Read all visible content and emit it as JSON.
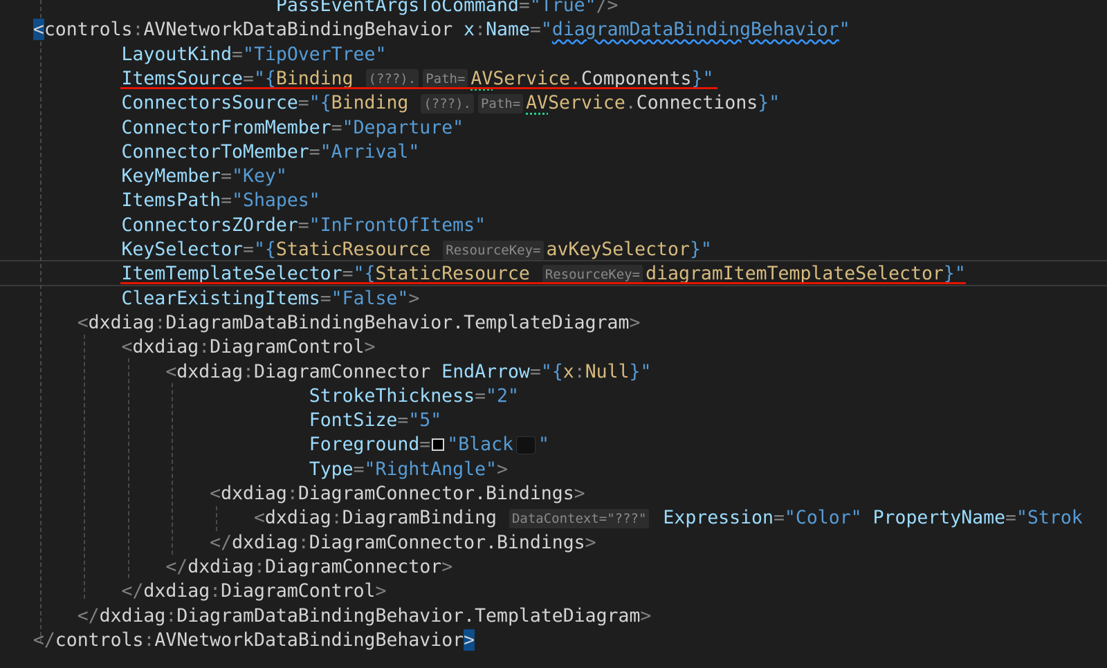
{
  "editor": {
    "lines": [
      {
        "indent": "                         ",
        "tokens": [
          {
            "t": "PassEventArgsToCommand",
            "c": "attr"
          },
          {
            "t": "=",
            "c": "punc"
          },
          {
            "t": "\"True\"",
            "c": "str"
          },
          {
            "t": "/>",
            "c": "punc"
          }
        ]
      },
      {
        "indent": "   ",
        "tokens": [
          {
            "t": "<",
            "c": "bracket-hl"
          },
          {
            "t": "controls",
            "c": "tag"
          },
          {
            "t": ":",
            "c": "punc"
          },
          {
            "t": "AVNetworkDataBindingBehavior",
            "c": "tag"
          },
          {
            "t": " ",
            "c": ""
          },
          {
            "t": "x",
            "c": "attr"
          },
          {
            "t": ":",
            "c": "punc"
          },
          {
            "t": "Name",
            "c": "attr"
          },
          {
            "t": "=",
            "c": "punc"
          },
          {
            "t": "\"",
            "c": "str"
          },
          {
            "t": "diagramDataBindingBehavior",
            "c": "str squig"
          },
          {
            "t": "\"",
            "c": "str"
          }
        ]
      },
      {
        "indent": "           ",
        "tokens": [
          {
            "t": "LayoutKind",
            "c": "attr"
          },
          {
            "t": "=",
            "c": "punc"
          },
          {
            "t": "\"TipOverTree\"",
            "c": "str"
          }
        ]
      },
      {
        "indent": "           ",
        "tokens": [
          {
            "t": "ItemsSource",
            "c": "attr"
          },
          {
            "t": "=",
            "c": "punc"
          },
          {
            "t": "\"{",
            "c": "str"
          },
          {
            "t": "Binding",
            "c": "keyword"
          },
          {
            "t": " ",
            "c": ""
          },
          {
            "t": "(???).",
            "c": "hint"
          },
          {
            "t": "Path=",
            "c": "hint"
          },
          {
            "t": "AV",
            "c": "keyword greendots"
          },
          {
            "t": "Service",
            "c": "keyword"
          },
          {
            "t": ".",
            "c": "punc"
          },
          {
            "t": "Components",
            "c": "ref"
          },
          {
            "t": "}\"",
            "c": "str"
          }
        ]
      },
      {
        "indent": "           ",
        "tokens": [
          {
            "t": "ConnectorsSource",
            "c": "attr"
          },
          {
            "t": "=",
            "c": "punc"
          },
          {
            "t": "\"{",
            "c": "str"
          },
          {
            "t": "Binding",
            "c": "keyword"
          },
          {
            "t": " ",
            "c": ""
          },
          {
            "t": "(???).",
            "c": "hint"
          },
          {
            "t": "Path=",
            "c": "hint"
          },
          {
            "t": "AV",
            "c": "keyword greendots"
          },
          {
            "t": "Service",
            "c": "keyword"
          },
          {
            "t": ".",
            "c": "punc"
          },
          {
            "t": "Connections",
            "c": "ref"
          },
          {
            "t": "}\"",
            "c": "str"
          }
        ]
      },
      {
        "indent": "           ",
        "tokens": [
          {
            "t": "ConnectorFromMember",
            "c": "attr"
          },
          {
            "t": "=",
            "c": "punc"
          },
          {
            "t": "\"Departure\"",
            "c": "str"
          }
        ]
      },
      {
        "indent": "           ",
        "tokens": [
          {
            "t": "ConnectorToMember",
            "c": "attr"
          },
          {
            "t": "=",
            "c": "punc"
          },
          {
            "t": "\"Arrival\"",
            "c": "str"
          }
        ]
      },
      {
        "indent": "           ",
        "tokens": [
          {
            "t": "KeyMember",
            "c": "attr"
          },
          {
            "t": "=",
            "c": "punc"
          },
          {
            "t": "\"Key\"",
            "c": "str"
          }
        ]
      },
      {
        "indent": "           ",
        "tokens": [
          {
            "t": "ItemsPath",
            "c": "attr"
          },
          {
            "t": "=",
            "c": "punc"
          },
          {
            "t": "\"Shapes\"",
            "c": "str"
          }
        ]
      },
      {
        "indent": "           ",
        "tokens": [
          {
            "t": "ConnectorsZOrder",
            "c": "attr"
          },
          {
            "t": "=",
            "c": "punc"
          },
          {
            "t": "\"InFrontOfItems\"",
            "c": "str"
          }
        ]
      },
      {
        "indent": "           ",
        "tokens": [
          {
            "t": "KeySelector",
            "c": "attr"
          },
          {
            "t": "=",
            "c": "punc"
          },
          {
            "t": "\"{",
            "c": "str"
          },
          {
            "t": "StaticResource",
            "c": "keyword"
          },
          {
            "t": " ",
            "c": ""
          },
          {
            "t": "ResourceKey=",
            "c": "hint"
          },
          {
            "t": "avKeySelector",
            "c": "keyword"
          },
          {
            "t": "}\"",
            "c": "str"
          }
        ]
      },
      {
        "indent": "           ",
        "tokens": [
          {
            "t": "ItemTemplateSelector",
            "c": "attr"
          },
          {
            "t": "=",
            "c": "punc"
          },
          {
            "t": "\"{",
            "c": "str"
          },
          {
            "t": "StaticResource",
            "c": "keyword"
          },
          {
            "t": " ",
            "c": ""
          },
          {
            "t": "ResourceKey=",
            "c": "hint"
          },
          {
            "t": "diagramItemTemplateSelector",
            "c": "keyword"
          },
          {
            "t": "}\"",
            "c": "str"
          }
        ]
      },
      {
        "indent": "           ",
        "tokens": [
          {
            "t": "ClearExistingItems",
            "c": "attr"
          },
          {
            "t": "=",
            "c": "punc"
          },
          {
            "t": "\"False\"",
            "c": "str"
          },
          {
            "t": ">",
            "c": "punc"
          }
        ]
      },
      {
        "indent": "       ",
        "tokens": [
          {
            "t": "<",
            "c": "punc"
          },
          {
            "t": "dxdiag",
            "c": "tag"
          },
          {
            "t": ":",
            "c": "punc"
          },
          {
            "t": "DiagramDataBindingBehavior.TemplateDiagram",
            "c": "tag"
          },
          {
            "t": ">",
            "c": "punc"
          }
        ]
      },
      {
        "indent": "           ",
        "tokens": [
          {
            "t": "<",
            "c": "punc"
          },
          {
            "t": "dxdiag",
            "c": "tag"
          },
          {
            "t": ":",
            "c": "punc"
          },
          {
            "t": "DiagramControl",
            "c": "tag"
          },
          {
            "t": ">",
            "c": "punc"
          }
        ]
      },
      {
        "indent": "               ",
        "tokens": [
          {
            "t": "<",
            "c": "punc"
          },
          {
            "t": "dxdiag",
            "c": "tag"
          },
          {
            "t": ":",
            "c": "punc"
          },
          {
            "t": "DiagramConnector",
            "c": "tag"
          },
          {
            "t": " ",
            "c": ""
          },
          {
            "t": "EndArrow",
            "c": "attr"
          },
          {
            "t": "=",
            "c": "punc"
          },
          {
            "t": "\"{",
            "c": "str"
          },
          {
            "t": "x",
            "c": "keyword"
          },
          {
            "t": ":",
            "c": "punc"
          },
          {
            "t": "Null",
            "c": "keyword"
          },
          {
            "t": "}\"",
            "c": "str"
          }
        ]
      },
      {
        "indent": "                            ",
        "tokens": [
          {
            "t": "StrokeThickness",
            "c": "attr"
          },
          {
            "t": "=",
            "c": "punc"
          },
          {
            "t": "\"2\"",
            "c": "str"
          }
        ]
      },
      {
        "indent": "                            ",
        "tokens": [
          {
            "t": "FontSize",
            "c": "attr"
          },
          {
            "t": "=",
            "c": "punc"
          },
          {
            "t": "\"5\"",
            "c": "str"
          }
        ]
      },
      {
        "indent": "                            ",
        "tokens": [
          {
            "t": "Foreground",
            "c": "attr"
          },
          {
            "t": "=",
            "c": "punc"
          },
          {
            "t": "",
            "c": "swatch"
          },
          {
            "t": "\"Black",
            "c": "str"
          },
          {
            "t": "",
            "c": "colorchip"
          },
          {
            "t": "\"",
            "c": "str"
          }
        ]
      },
      {
        "indent": "                            ",
        "tokens": [
          {
            "t": "Type",
            "c": "attr"
          },
          {
            "t": "=",
            "c": "punc"
          },
          {
            "t": "\"RightAngle\"",
            "c": "str"
          },
          {
            "t": ">",
            "c": "punc"
          }
        ]
      },
      {
        "indent": "                   ",
        "tokens": [
          {
            "t": "<",
            "c": "punc"
          },
          {
            "t": "dxdiag",
            "c": "tag"
          },
          {
            "t": ":",
            "c": "punc"
          },
          {
            "t": "DiagramConnector.Bindings",
            "c": "tag"
          },
          {
            "t": ">",
            "c": "punc"
          }
        ]
      },
      {
        "indent": "                       ",
        "tokens": [
          {
            "t": "<",
            "c": "punc"
          },
          {
            "t": "dxdiag",
            "c": "tag"
          },
          {
            "t": ":",
            "c": "punc"
          },
          {
            "t": "DiagramBinding",
            "c": "tag"
          },
          {
            "t": " ",
            "c": ""
          },
          {
            "t": "DataContext=\"???\"",
            "c": "hint"
          },
          {
            "t": " ",
            "c": ""
          },
          {
            "t": "Expression",
            "c": "attr"
          },
          {
            "t": "=",
            "c": "punc"
          },
          {
            "t": "\"Color\"",
            "c": "str"
          },
          {
            "t": " ",
            "c": ""
          },
          {
            "t": "PropertyName",
            "c": "attr"
          },
          {
            "t": "=",
            "c": "punc"
          },
          {
            "t": "\"Strok",
            "c": "str"
          }
        ]
      },
      {
        "indent": "                   ",
        "tokens": [
          {
            "t": "</",
            "c": "punc"
          },
          {
            "t": "dxdiag",
            "c": "tag"
          },
          {
            "t": ":",
            "c": "punc"
          },
          {
            "t": "DiagramConnector.Bindings",
            "c": "tag"
          },
          {
            "t": ">",
            "c": "punc"
          }
        ]
      },
      {
        "indent": "               ",
        "tokens": [
          {
            "t": "</",
            "c": "punc"
          },
          {
            "t": "dxdiag",
            "c": "tag"
          },
          {
            "t": ":",
            "c": "punc"
          },
          {
            "t": "DiagramConnector",
            "c": "tag"
          },
          {
            "t": ">",
            "c": "punc"
          }
        ]
      },
      {
        "indent": "           ",
        "tokens": [
          {
            "t": "</",
            "c": "punc"
          },
          {
            "t": "dxdiag",
            "c": "tag"
          },
          {
            "t": ":",
            "c": "punc"
          },
          {
            "t": "DiagramControl",
            "c": "tag"
          },
          {
            "t": ">",
            "c": "punc"
          }
        ]
      },
      {
        "indent": "       ",
        "tokens": [
          {
            "t": "</",
            "c": "punc"
          },
          {
            "t": "dxdiag",
            "c": "tag"
          },
          {
            "t": ":",
            "c": "punc"
          },
          {
            "t": "DiagramDataBindingBehavior.TemplateDiagram",
            "c": "tag"
          },
          {
            "t": ">",
            "c": "punc"
          }
        ]
      },
      {
        "indent": "   ",
        "tokens": [
          {
            "t": "</",
            "c": "punc"
          },
          {
            "t": "controls",
            "c": "tag"
          },
          {
            "t": ":",
            "c": "punc"
          },
          {
            "t": "AVNetworkDataBindingBehavior",
            "c": "tag"
          },
          {
            "t": ">",
            "c": "bracket-hl"
          }
        ]
      }
    ],
    "colors": {
      "background": "#1e1e1e",
      "tag": "#d4d4d4",
      "attribute": "#9cdcfe",
      "string": "#569cd6",
      "markup_extension": "#d7ba7d",
      "annotation_underline": "#e51400",
      "diagnostic_dots": "#23d18b"
    },
    "highlighted_lines": [
      "ItemsSource",
      "ItemTemplateSelector"
    ]
  }
}
